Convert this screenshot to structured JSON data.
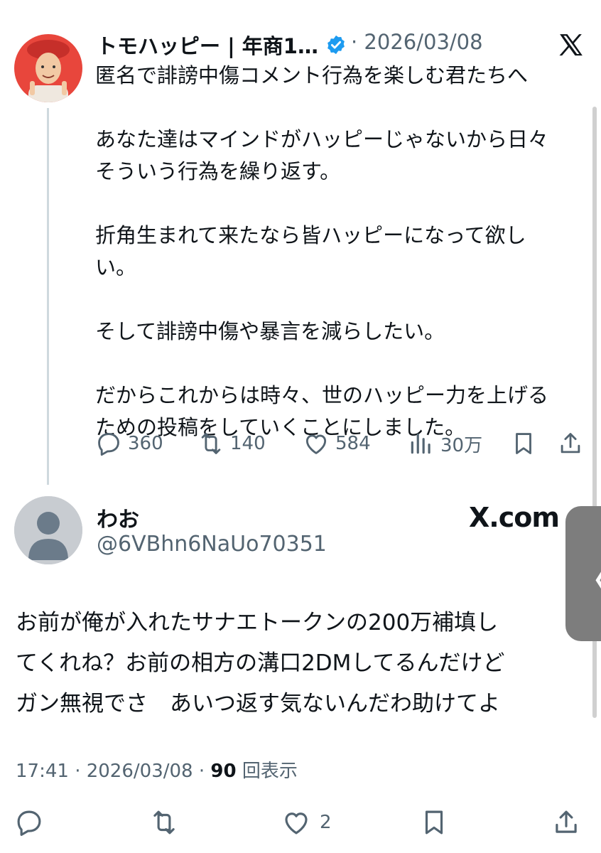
{
  "tweet": {
    "display_name": "トモハッピー | 年商1…",
    "date": "· 2026/03/08",
    "text": "匿名で誹謗中傷コメント行為を楽しむ君たちへ\n\nあなた達はマインドがハッピーじゃないから日々\nそういう行為を繰り返す。\n\n折角生まれて来たなら皆ハッピーになって欲し\nい。\n\nそして誹謗中傷や暴言を減らしたい。\n\nだからこれからは時々、世のハッピー力を上げる\nための投稿をしていくことにしました。",
    "replies": "360",
    "retweets": "140",
    "likes": "584",
    "views": "30万",
    "icons": [
      "avatar-photo",
      "verified-badge-icon",
      "x-logo-icon",
      "reply-icon",
      "retweet-icon",
      "like-icon",
      "views-icon",
      "bookmark-icon",
      "share-icon"
    ],
    "colors": {
      "verified": "#1d9bf0",
      "muted": "#536471",
      "avatar_bg": "#e8463c"
    }
  },
  "reply": {
    "display_name": "わお",
    "handle": "@6VBhn6NaUo70351",
    "watermark": "X.com",
    "text": "お前が俺が入れたサナエトークンの200万補填し\nてくれね？お前の相方の溝口2DMしてるんだけど\nガン無視でさ　あいつ返す気ないんだわ助けてよ",
    "time": "17:41 · 2026/03/08 · ",
    "views_count": "90",
    "views_label": "回表示",
    "likes": "2",
    "icons": [
      "default-avatar",
      "reply-icon",
      "retweet-icon",
      "like-icon",
      "bookmark-icon",
      "share-icon"
    ]
  },
  "side_handle": {
    "chevron": "〈"
  }
}
